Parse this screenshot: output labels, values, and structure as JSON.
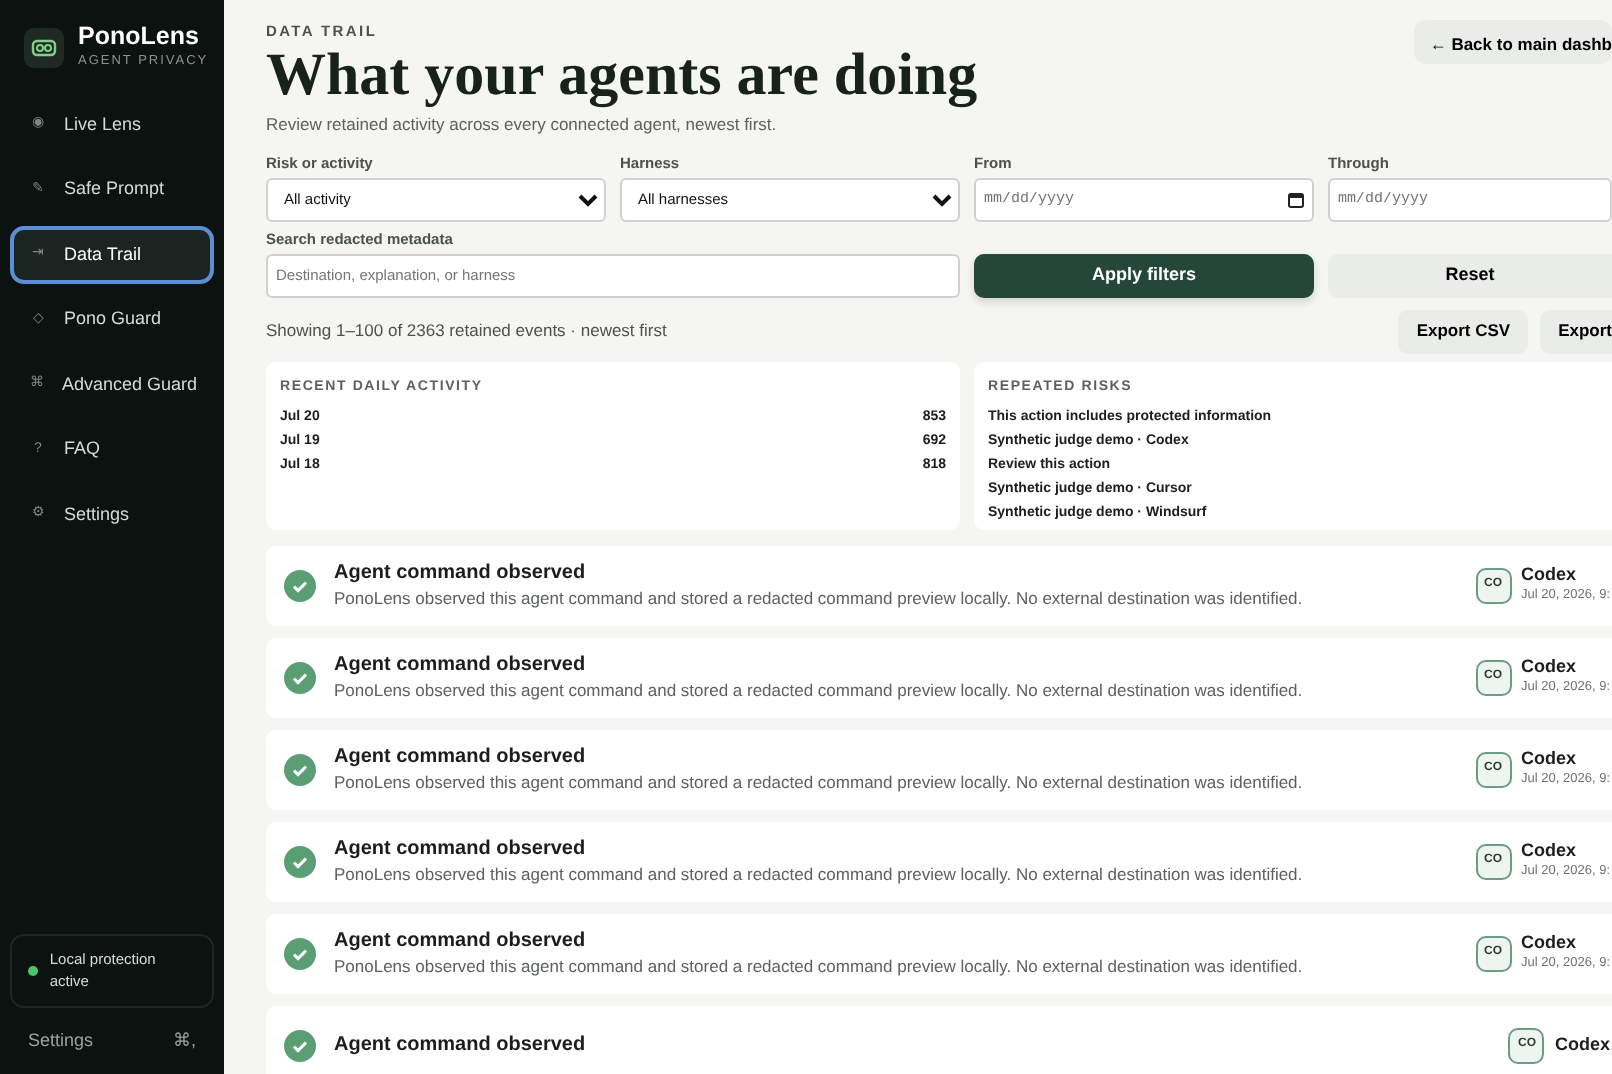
{
  "sidebar": {
    "brand": "PonoLens",
    "tagline": "AGENT PRIVACY",
    "items": [
      {
        "icon": "◉",
        "label": "Live Lens",
        "selected": false
      },
      {
        "icon": "✎",
        "label": "Safe Prompt",
        "selected": false
      },
      {
        "icon": "⇥",
        "label": "Data Trail",
        "selected": true
      },
      {
        "icon": "◇",
        "label": "Pono Guard",
        "selected": false
      },
      {
        "icon": "⌘",
        "label": "Advanced Guard",
        "selected": false
      },
      {
        "icon": "?",
        "label": "FAQ",
        "selected": false
      },
      {
        "icon": "⚙",
        "label": "Settings",
        "selected": false
      }
    ],
    "status": {
      "label": "Local protection active",
      "color": "#4cc46a"
    },
    "footer": {
      "label": "Settings",
      "shortcut": "⌘,"
    }
  },
  "header": {
    "eyebrow": "DATA TRAIL",
    "title": "What your agents are doing",
    "subtitle": "Review retained activity across every connected agent, newest first.",
    "back_button": "← Back to main dashb"
  },
  "filters": {
    "fields": [
      {
        "kind": "select",
        "label": "Risk or activity",
        "value": "All activity"
      },
      {
        "kind": "select",
        "label": "Harness",
        "value": "All harnesses"
      },
      {
        "kind": "date",
        "label": "From",
        "placeholder": "mm/dd/yyyy",
        "calendar": true
      },
      {
        "kind": "date",
        "label": "Through",
        "placeholder": "mm/dd/yyyy"
      }
    ],
    "search": {
      "label": "Search redacted metadata",
      "placeholder": "Destination, explanation, or harness"
    },
    "apply": "Apply filters",
    "reset": "Reset"
  },
  "summary": {
    "text": "Showing 1–100 of 2363 retained events · newest first",
    "exports": [
      "Export CSV",
      "Export"
    ]
  },
  "daily": {
    "title": "RECENT DAILY ACTIVITY",
    "rows": [
      {
        "date": "Jul 20",
        "count": "853"
      },
      {
        "date": "Jul 19",
        "count": "692"
      },
      {
        "date": "Jul 18",
        "count": "818"
      }
    ]
  },
  "risks": {
    "title": "REPEATED RISKS",
    "items": [
      "This action includes protected information",
      "Synthetic judge demo · Codex",
      "Review this action",
      "Synthetic judge demo · Cursor",
      "Synthetic judge demo · Windsurf"
    ]
  },
  "events": [
    {
      "title": "Agent command observed",
      "description": "PonoLens observed this agent command and stored a redacted command preview locally. No external destination was identified.",
      "badge": "CO",
      "source": "Codex",
      "time": "Jul 20, 2026, 9:"
    },
    {
      "title": "Agent command observed",
      "description": "PonoLens observed this agent command and stored a redacted command preview locally. No external destination was identified.",
      "badge": "CO",
      "source": "Codex",
      "time": "Jul 20, 2026, 9:"
    },
    {
      "title": "Agent command observed",
      "description": "PonoLens observed this agent command and stored a redacted command preview locally. No external destination was identified.",
      "badge": "CO",
      "source": "Codex",
      "time": "Jul 20, 2026, 9:"
    },
    {
      "title": "Agent command observed",
      "description": "PonoLens observed this agent command and stored a redacted command preview locally. No external destination was identified.",
      "badge": "CO",
      "source": "Codex",
      "time": "Jul 20, 2026, 9:"
    },
    {
      "title": "Agent command observed",
      "description": "PonoLens observed this agent command and stored a redacted command preview locally. No external destination was identified.",
      "badge": "CO",
      "source": "Codex",
      "time": "Jul 20, 2026, 9:"
    },
    {
      "title": "Agent command observed",
      "badge": "CO",
      "source": "Codex"
    }
  ]
}
